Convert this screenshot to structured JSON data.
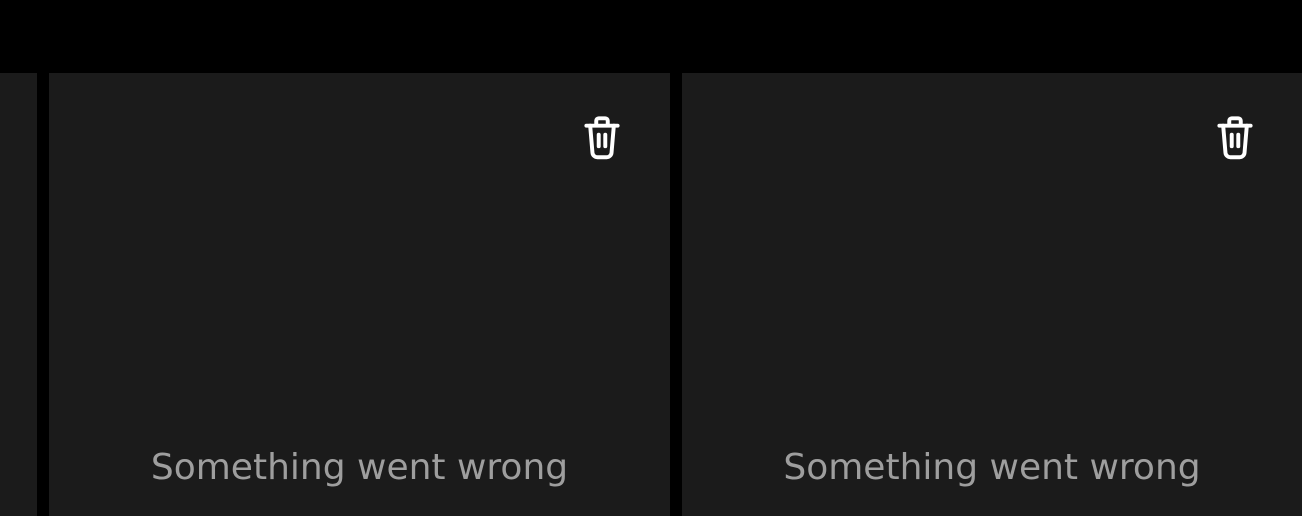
{
  "cards": [
    {
      "error_message": "Something went wrong",
      "delete_icon": "trash-icon"
    },
    {
      "error_message": "Something went wrong",
      "delete_icon": "trash-icon"
    }
  ],
  "colors": {
    "background": "#000000",
    "card": "#1b1b1b",
    "error_text": "#9e9e9e",
    "icon": "#ffffff"
  }
}
